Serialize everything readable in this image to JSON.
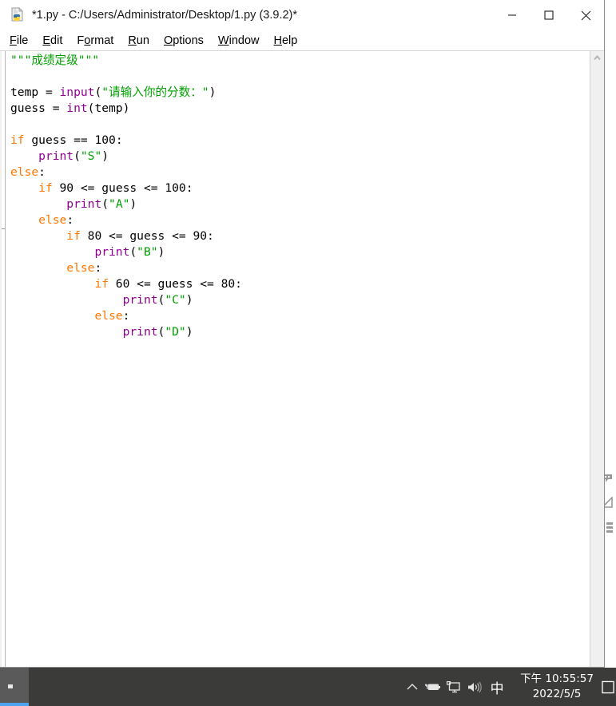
{
  "window": {
    "title": "*1.py - C:/Users/Administrator/Desktop/1.py (3.9.2)*",
    "app_icon": "python-file-icon",
    "controls": {
      "minimize": "minimize-button",
      "maximize": "maximize-button",
      "close": "close-button"
    }
  },
  "menu": {
    "items": [
      {
        "label": "File",
        "mnemonic": "F"
      },
      {
        "label": "Edit",
        "mnemonic": "E"
      },
      {
        "label": "Format",
        "mnemonic": "o"
      },
      {
        "label": "Run",
        "mnemonic": "R"
      },
      {
        "label": "Options",
        "mnemonic": "O"
      },
      {
        "label": "Window",
        "mnemonic": "W"
      },
      {
        "label": "Help",
        "mnemonic": "H"
      }
    ]
  },
  "editor": {
    "language": "python",
    "code_lines": [
      "\"\"\"成绩定级\"\"\"",
      "",
      "temp = input(\"请输入你的分数：\")",
      "guess = int(temp)",
      "",
      "if guess == 100:",
      "    print(\"S\")",
      "else:",
      "    if 90 <= guess <= 100:",
      "        print(\"A\")",
      "    else:",
      "        if 80 <= guess <= 90:",
      "            print(\"B\")",
      "        else:",
      "            if 60 <= guess <= 80:",
      "                print(\"C\")",
      "            else:",
      "                print(\"D\")"
    ],
    "syntax_colors": {
      "string": "#00a000",
      "keyword": "#ff7700",
      "builtin": "#900090",
      "definition": "#0000ff",
      "plain": "#000000",
      "background": "#ffffff"
    },
    "scrollbar": {
      "up_arrow": "scroll-up-arrow",
      "down_arrow": "scroll-down-arrow"
    }
  },
  "taskbar": {
    "background": "#3b3b3a",
    "active_task": {
      "name": "idle-taskbar-item",
      "accent": "#4ea3f0"
    },
    "tray_icons": [
      {
        "name": "show-hidden-icons-chevron",
        "glyph": "chevron-up"
      },
      {
        "name": "battery-charging-icon",
        "glyph": "battery"
      },
      {
        "name": "network-monitor-icon",
        "glyph": "monitor"
      },
      {
        "name": "volume-speaker-icon",
        "glyph": "speaker"
      }
    ],
    "ime": {
      "name": "ime-indicator",
      "label": "中"
    },
    "clock": {
      "time": "下午 10:55:57",
      "date": "2022/5/5"
    },
    "action_center": "action-center-icon"
  },
  "background_window": {
    "tool_icons": [
      {
        "name": "bg-pen-tool-icon"
      },
      {
        "name": "bg-shape-tool-icon"
      },
      {
        "name": "bg-list-tool-icon"
      }
    ]
  }
}
